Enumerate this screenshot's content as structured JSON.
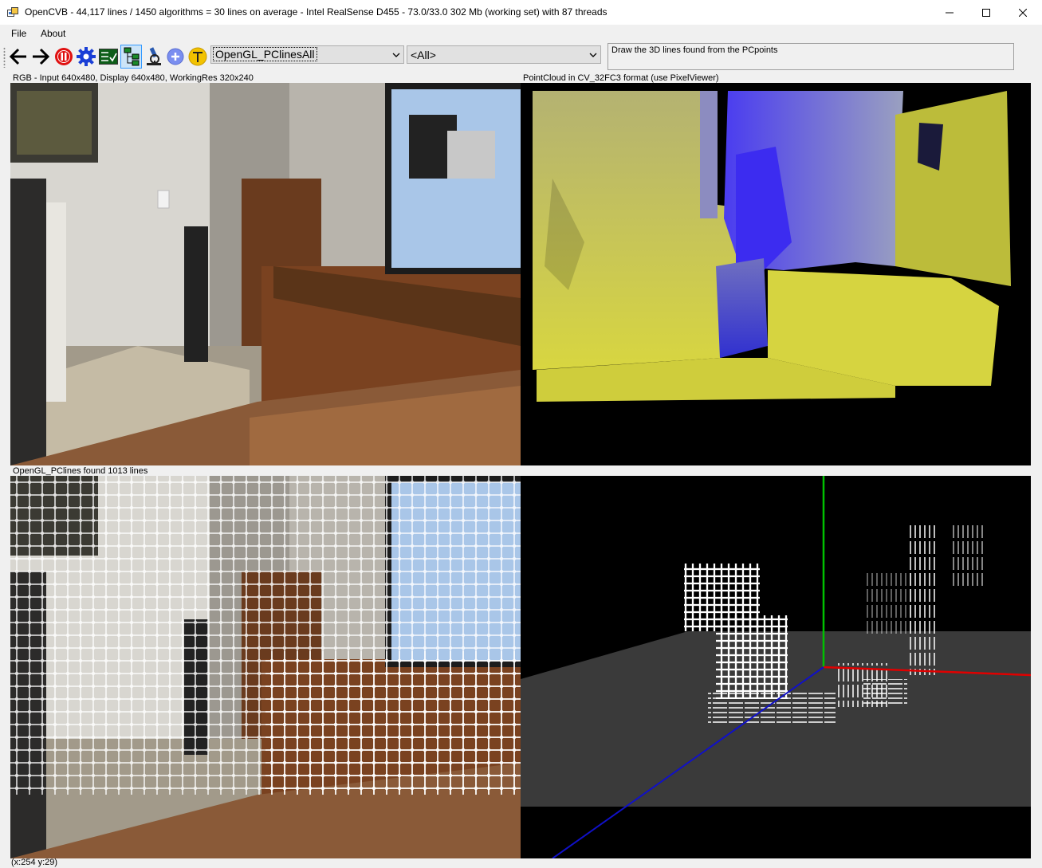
{
  "window": {
    "title": "OpenCVB - 44,117 lines / 1450 algorithms = 30 lines on average - Intel RealSense D455 - 73.0/33.0 302 Mb (working set) with 87 threads",
    "minimize_icon": "minimize-icon",
    "maximize_icon": "maximize-icon",
    "close_icon": "close-icon"
  },
  "menu": {
    "file_label": "File",
    "about_label": "About"
  },
  "toolbar": {
    "icons": [
      "back-arrow-icon",
      "forward-arrow-icon",
      "pause-icon",
      "gear-icon",
      "test-all-icon",
      "tree-view-icon",
      "microscope-icon",
      "plus-icon",
      "translate-icon"
    ],
    "algorithm_select": "OpenGL_PClinesAll",
    "group_select": "<All>",
    "description": "Draw the 3D lines found from the PCpoints"
  },
  "panels": {
    "rgb_label": "RGB - Input 640x480, Display 640x480, WorkingRes 320x240",
    "pointcloud_label": "PointCloud in CV_32FC3 format (use PixelViewer)",
    "result_label": "OpenGL_PClines found 1013 lines",
    "opengl_label": ""
  },
  "status": {
    "coords": "(x:254 y:29)"
  },
  "colors": {
    "axis_x": "#e00000",
    "axis_y": "#00c000",
    "axis_z": "#1010c8",
    "depth_near": "#c8c830",
    "depth_far": "#3020e0"
  }
}
